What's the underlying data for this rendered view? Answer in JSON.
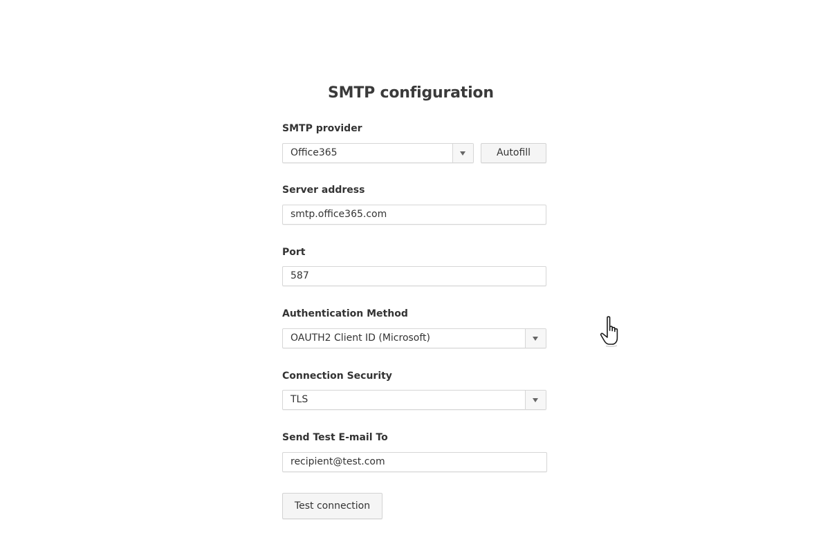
{
  "page": {
    "title": "SMTP configuration"
  },
  "form": {
    "smtp_provider": {
      "label": "SMTP provider",
      "value": "Office365",
      "autofill_label": "Autofill"
    },
    "server_address": {
      "label": "Server address",
      "value": "smtp.office365.com"
    },
    "port": {
      "label": "Port",
      "value": "587"
    },
    "authentication_method": {
      "label": "Authentication Method",
      "value": "OAUTH2 Client ID (Microsoft)"
    },
    "connection_security": {
      "label": "Connection Security",
      "value": "TLS"
    },
    "test_email": {
      "label": "Send Test E-mail To",
      "value": "recipient@test.com"
    },
    "test_button_label": "Test connection"
  },
  "icons": {
    "dropdown": "chevron-down-icon",
    "cursor": "hand-pointer-icon"
  },
  "colors": {
    "text": "#333333",
    "border": "#d6d6d6",
    "button_bg": "#f5f5f5"
  }
}
